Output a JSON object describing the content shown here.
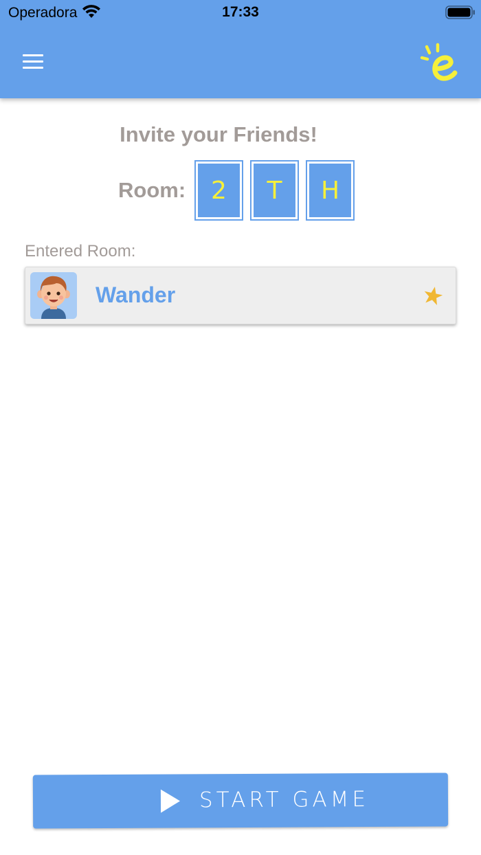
{
  "status_bar": {
    "carrier": "Operadora",
    "time": "17:33",
    "wifi_icon": "wifi-icon",
    "battery_icon": "battery-icon"
  },
  "header": {
    "menu_icon": "hamburger-menu-icon",
    "logo_icon": "e-logo-icon",
    "background_color": "#64A0EA",
    "logo_color": "#F6F03A"
  },
  "invite": {
    "title": "Invite your Friends!",
    "room_label": "Room:",
    "room_code": [
      "2",
      "T",
      "H"
    ]
  },
  "entered_room": {
    "label": "Entered Room:",
    "players": [
      {
        "name": "Wander",
        "avatar_icon": "boy-avatar-icon",
        "host_icon": "star-icon"
      }
    ]
  },
  "start_button": {
    "label": "START GAME",
    "icon": "play-icon"
  },
  "colors": {
    "accent": "#64A0EA",
    "muted_text": "#A29B98",
    "code_text": "#F6F03A",
    "star": "#F0B733"
  }
}
